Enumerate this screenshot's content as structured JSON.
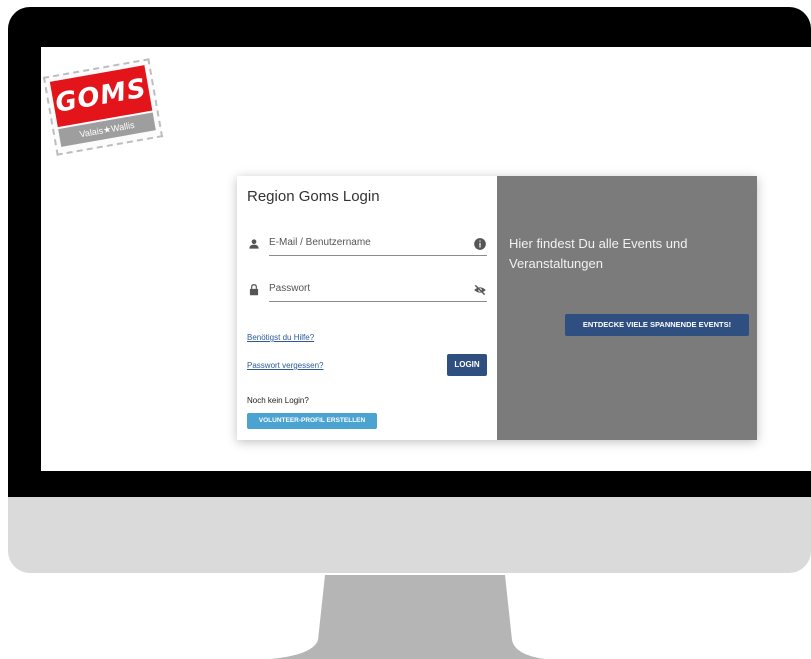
{
  "brand": {
    "logo_text": "GOMS",
    "logo_subtext": "Valais★Wallis",
    "red": "#e4141b"
  },
  "login": {
    "title": "Region Goms Login",
    "email_placeholder": "E-Mail / Benutzername",
    "password_placeholder": "Passwort",
    "help_link": "Benötigst du Hilfe?",
    "forgot_link": "Passwort vergessen?",
    "login_button": "LOGIN",
    "no_login_text": "Noch kein Login?",
    "volunteer_button": "VOLUNTEER-PROFIL ERSTELLEN"
  },
  "promo": {
    "text": "Hier findest Du alle Events und Veranstaltungen",
    "button": "ENTDECKE VIELE SPANNENDE EVENTS!"
  },
  "colors": {
    "primary_button": "#2e4f80",
    "secondary_button": "#4aa3d0",
    "promo_panel": "#7b7b7b"
  },
  "icons": {
    "user": "person-icon",
    "info": "info-icon",
    "lock": "lock-icon",
    "visibility": "eye-off-icon"
  }
}
